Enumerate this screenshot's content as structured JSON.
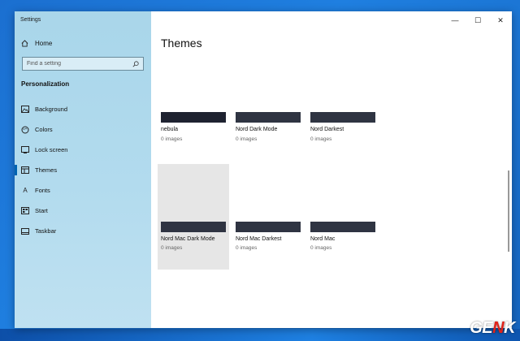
{
  "window": {
    "title": "Settings",
    "controls": {
      "minimize": "—",
      "maximize": "☐",
      "close": "✕"
    }
  },
  "sidebar": {
    "home_label": "Home",
    "search": {
      "placeholder": "Find a setting"
    },
    "section_title": "Personalization",
    "items": [
      {
        "label": "Background",
        "icon": "picture-icon"
      },
      {
        "label": "Colors",
        "icon": "palette-icon"
      },
      {
        "label": "Lock screen",
        "icon": "lock-screen-icon"
      },
      {
        "label": "Themes",
        "icon": "themes-icon",
        "selected": true
      },
      {
        "label": "Fonts",
        "icon": "fonts-icon"
      },
      {
        "label": "Start",
        "icon": "start-icon"
      },
      {
        "label": "Taskbar",
        "icon": "taskbar-icon"
      }
    ]
  },
  "main": {
    "title": "Themes",
    "themes": [
      {
        "name": "nebula",
        "count": "0 images",
        "swatch": "#1e2230"
      },
      {
        "name": "Nord Dark Mode",
        "count": "0 images",
        "swatch": "#2f3442"
      },
      {
        "name": "Nord Darkest",
        "count": "0 images",
        "swatch": "#2f3442"
      },
      {
        "name": "Nord Mac Dark Mode",
        "count": "0 images",
        "swatch": "#2f3442",
        "hovered": true
      },
      {
        "name": "Nord Mac Darkest",
        "count": "0 images",
        "swatch": "#2f3442"
      },
      {
        "name": "Nord Mac",
        "count": "0 images",
        "swatch": "#2f3442"
      }
    ]
  },
  "watermark": {
    "part1": "GE",
    "part2": "N",
    "part3": "K"
  },
  "colors": {
    "sidebar": "#b2dbee",
    "accent": "#0063b1",
    "desktop": "#1b6fd0"
  }
}
